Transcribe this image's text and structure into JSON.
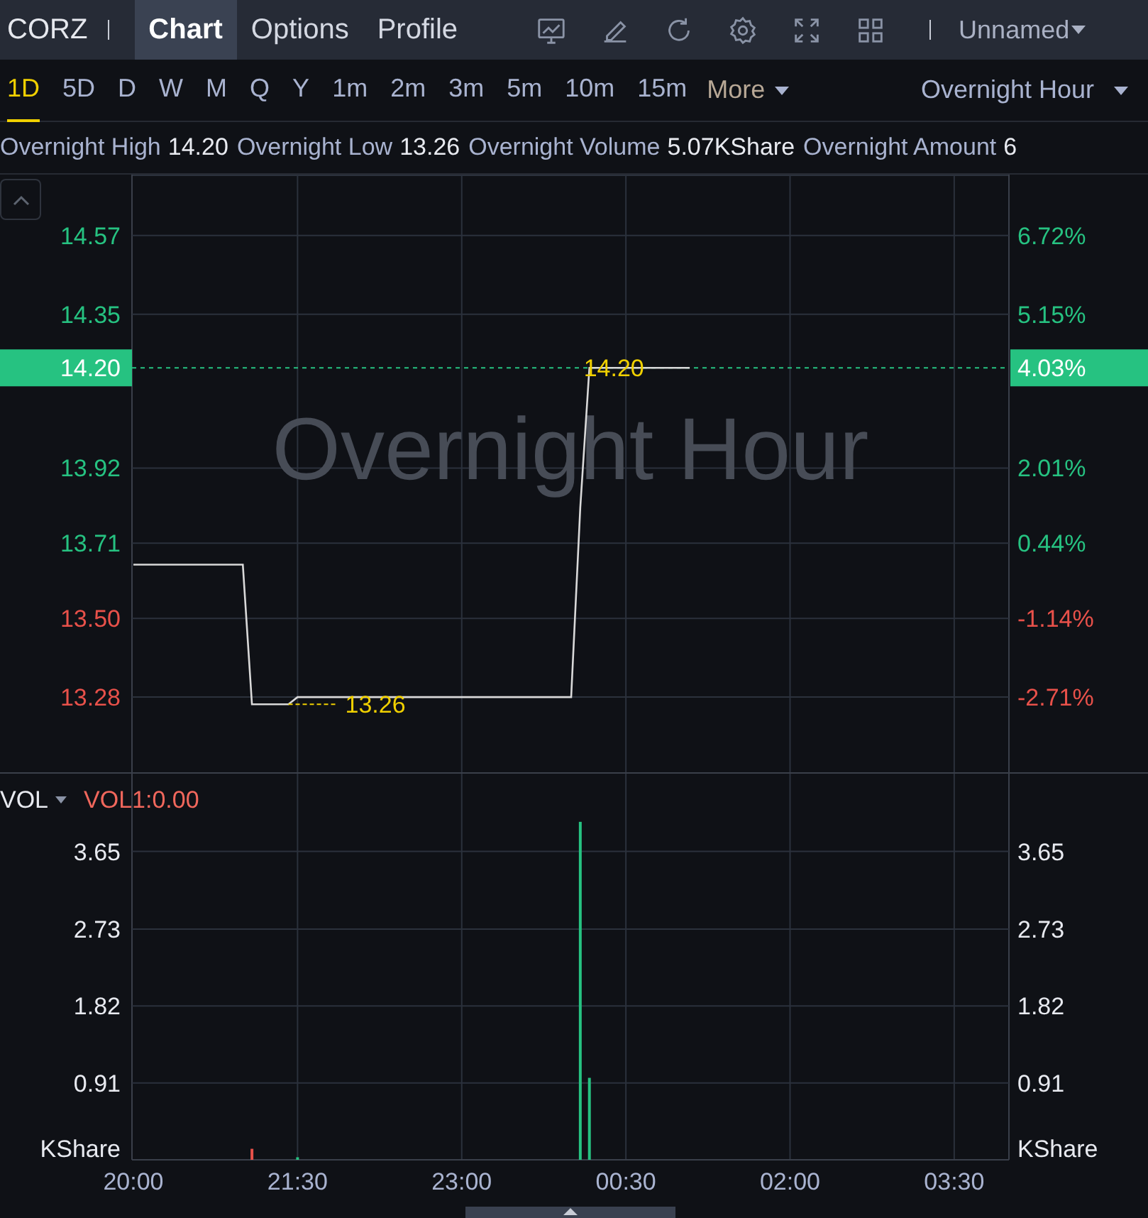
{
  "header": {
    "symbol": "CORZ",
    "tabs": [
      {
        "label": "Chart",
        "selected": true
      },
      {
        "label": "Options",
        "selected": false
      },
      {
        "label": "Profile",
        "selected": false
      }
    ],
    "layout_name": "Unnamed"
  },
  "timeframes": [
    {
      "label": "1D",
      "selected": true
    },
    {
      "label": "5D",
      "selected": false
    },
    {
      "label": "D",
      "selected": false
    },
    {
      "label": "W",
      "selected": false
    },
    {
      "label": "M",
      "selected": false
    },
    {
      "label": "Q",
      "selected": false
    },
    {
      "label": "Y",
      "selected": false
    },
    {
      "label": "1m",
      "selected": false
    },
    {
      "label": "2m",
      "selected": false
    },
    {
      "label": "3m",
      "selected": false
    },
    {
      "label": "5m",
      "selected": false
    },
    {
      "label": "10m",
      "selected": false
    },
    {
      "label": "15m",
      "selected": false
    }
  ],
  "more": "More",
  "session": "Overnight Hour",
  "stats": [
    {
      "label": "Overnight High",
      "value": "14.20"
    },
    {
      "label": "Overnight Low",
      "value": "13.26"
    },
    {
      "label": "Overnight Volume",
      "value": "5.07KShare"
    },
    {
      "label": "Overnight Amount",
      "value": "6"
    }
  ],
  "price_chart": {
    "watermark": "Overnight Hour",
    "last_price_tag": {
      "price": "14.20",
      "change": "4.03%"
    },
    "percent_axis": [
      {
        "label": "6.72%",
        "color": "#26c281"
      },
      {
        "label": "5.15%",
        "color": "#26c281"
      },
      {
        "label": "2.01%",
        "color": "#26c281"
      },
      {
        "label": "0.44%",
        "color": "#26c281"
      },
      {
        "label": "-1.14%",
        "color": "#e8514a"
      },
      {
        "label": "-2.71%",
        "color": "#e8514a"
      }
    ],
    "chart_data": {
      "type": "line",
      "categories": [
        null,
        null,
        null,
        null,
        null,
        null,
        null,
        null,
        null,
        null,
        null,
        null,
        null,
        null,
        null,
        null,
        null,
        null,
        null,
        null,
        null,
        null,
        null,
        null,
        null,
        null,
        null,
        null,
        null,
        null,
        null,
        null,
        null,
        null,
        null,
        null,
        null,
        null,
        null,
        null,
        null,
        null,
        null,
        null,
        null,
        null,
        null,
        null,
        null,
        null,
        null,
        null,
        null,
        null,
        null,
        null,
        null,
        null,
        null,
        null,
        null,
        null,
        null,
        null,
        null,
        null,
        null,
        null,
        null,
        null,
        null,
        null,
        null,
        null,
        null,
        null,
        null,
        null,
        null,
        null,
        null,
        null,
        null,
        null,
        null,
        null,
        null,
        null,
        null,
        null,
        null,
        null,
        null,
        null,
        null,
        null
      ],
      "series": [
        {
          "color": "#d9d9d9",
          "values": [
            13.65,
            13.65,
            13.65,
            13.65,
            13.65,
            13.65,
            13.65,
            13.65,
            13.65,
            13.65,
            13.65,
            13.65,
            13.65,
            13.26,
            13.26,
            13.26,
            13.26,
            13.26,
            13.28,
            13.28,
            13.28,
            13.28,
            13.28,
            13.28,
            13.28,
            13.28,
            13.28,
            13.28,
            13.28,
            13.28,
            13.28,
            13.28,
            13.28,
            13.28,
            13.28,
            13.28,
            13.28,
            13.28,
            13.28,
            13.28,
            13.28,
            13.28,
            13.28,
            13.28,
            13.28,
            13.28,
            13.28,
            13.28,
            13.28,
            13.81,
            14.2,
            14.2,
            14.2,
            14.2,
            14.2,
            14.2,
            14.2,
            14.2,
            14.2,
            14.2,
            14.2,
            14.2,
            null,
            null,
            null,
            null,
            null,
            null,
            null,
            null,
            null,
            null,
            null,
            null,
            null,
            null,
            null,
            null,
            null,
            null,
            null,
            null,
            null,
            null,
            null,
            null,
            null,
            null,
            null,
            null,
            null,
            null,
            null,
            null,
            null,
            null
          ]
        }
      ],
      "ylim": [
        13.07,
        14.74
      ],
      "yticks": [
        {
          "value": 14.57,
          "label": "14.57"
        },
        {
          "value": 14.35,
          "label": "14.35"
        },
        {
          "value": 13.92,
          "label": "13.92"
        },
        {
          "value": 13.71,
          "label": "13.71"
        },
        {
          "value": 13.5,
          "label": "13.50"
        },
        {
          "value": 13.28,
          "label": "13.28"
        }
      ],
      "grid": true,
      "ref_lines": [
        {
          "axis": "y",
          "value": 14.2,
          "color": "#26c281"
        }
      ],
      "annotations": [
        "14.20",
        "13.26"
      ]
    }
  },
  "volume_chart": {
    "indicator": "VOL",
    "indicator_value": "VOL1:0.00",
    "right_unit": "KShare",
    "chart_data": {
      "type": "bar",
      "categories": [
        "20:00",
        null,
        null,
        null,
        null,
        null,
        null,
        null,
        null,
        null,
        null,
        null,
        null,
        null,
        null,
        null,
        null,
        null,
        "21:30",
        null,
        null,
        null,
        null,
        null,
        null,
        null,
        null,
        null,
        null,
        null,
        null,
        null,
        null,
        null,
        null,
        null,
        "23:00",
        null,
        null,
        null,
        null,
        null,
        null,
        null,
        null,
        null,
        null,
        null,
        null,
        null,
        null,
        null,
        null,
        null,
        "00:30",
        null,
        null,
        null,
        null,
        null,
        null,
        null,
        null,
        null,
        null,
        null,
        null,
        null,
        null,
        null,
        null,
        null,
        "02:00",
        null,
        null,
        null,
        null,
        null,
        null,
        null,
        null,
        null,
        null,
        null,
        null,
        null,
        null,
        null,
        null,
        null,
        "03:30",
        null,
        null,
        null,
        null,
        null
      ],
      "series": [
        {
          "color": "#e8514a",
          "values": [
            null,
            null,
            null,
            null,
            null,
            null,
            null,
            null,
            null,
            null,
            null,
            null,
            null,
            0.13,
            null,
            null,
            null,
            null,
            null,
            null,
            null,
            null,
            null,
            null,
            null,
            null,
            null,
            null,
            null,
            null,
            null,
            null,
            null,
            null,
            null,
            null,
            null,
            null,
            null,
            null,
            null,
            null,
            null,
            null,
            null,
            null,
            null,
            null,
            null,
            null,
            null,
            null,
            null,
            null,
            null,
            null,
            null,
            null,
            null,
            null,
            null,
            null,
            null,
            null,
            null,
            null,
            null,
            null,
            null,
            null,
            null,
            null,
            null,
            null,
            null,
            null,
            null,
            null,
            null,
            null,
            null,
            null,
            null,
            null,
            null,
            null,
            null,
            null,
            null,
            null,
            null,
            null,
            null,
            null,
            null,
            null
          ]
        },
        {
          "color": "#26c281",
          "values": [
            null,
            null,
            null,
            null,
            null,
            null,
            null,
            null,
            null,
            null,
            null,
            null,
            null,
            null,
            null,
            null,
            null,
            null,
            0.03,
            null,
            null,
            null,
            null,
            null,
            null,
            null,
            null,
            null,
            null,
            null,
            null,
            null,
            null,
            null,
            null,
            null,
            null,
            null,
            null,
            null,
            null,
            null,
            null,
            null,
            null,
            null,
            null,
            null,
            null,
            4.0,
            0.97,
            null,
            null,
            null,
            null,
            null,
            null,
            null,
            null,
            null,
            null,
            null,
            null,
            null,
            null,
            null,
            null,
            null,
            null,
            null,
            null,
            null,
            null,
            null,
            null,
            null,
            null,
            null,
            null,
            null,
            null,
            null,
            null,
            null,
            null,
            null,
            null,
            null,
            null,
            null,
            null,
            null,
            null,
            null,
            null,
            null
          ]
        }
      ],
      "ylim": [
        0,
        4.57
      ],
      "ylabel": "KShare",
      "grid": true,
      "yticks": [
        {
          "value": 0.91,
          "label": "0.91"
        },
        {
          "value": 1.82,
          "label": "1.82"
        },
        {
          "value": 2.73,
          "label": "2.73"
        },
        {
          "value": 3.65,
          "label": "3.65"
        }
      ]
    }
  }
}
